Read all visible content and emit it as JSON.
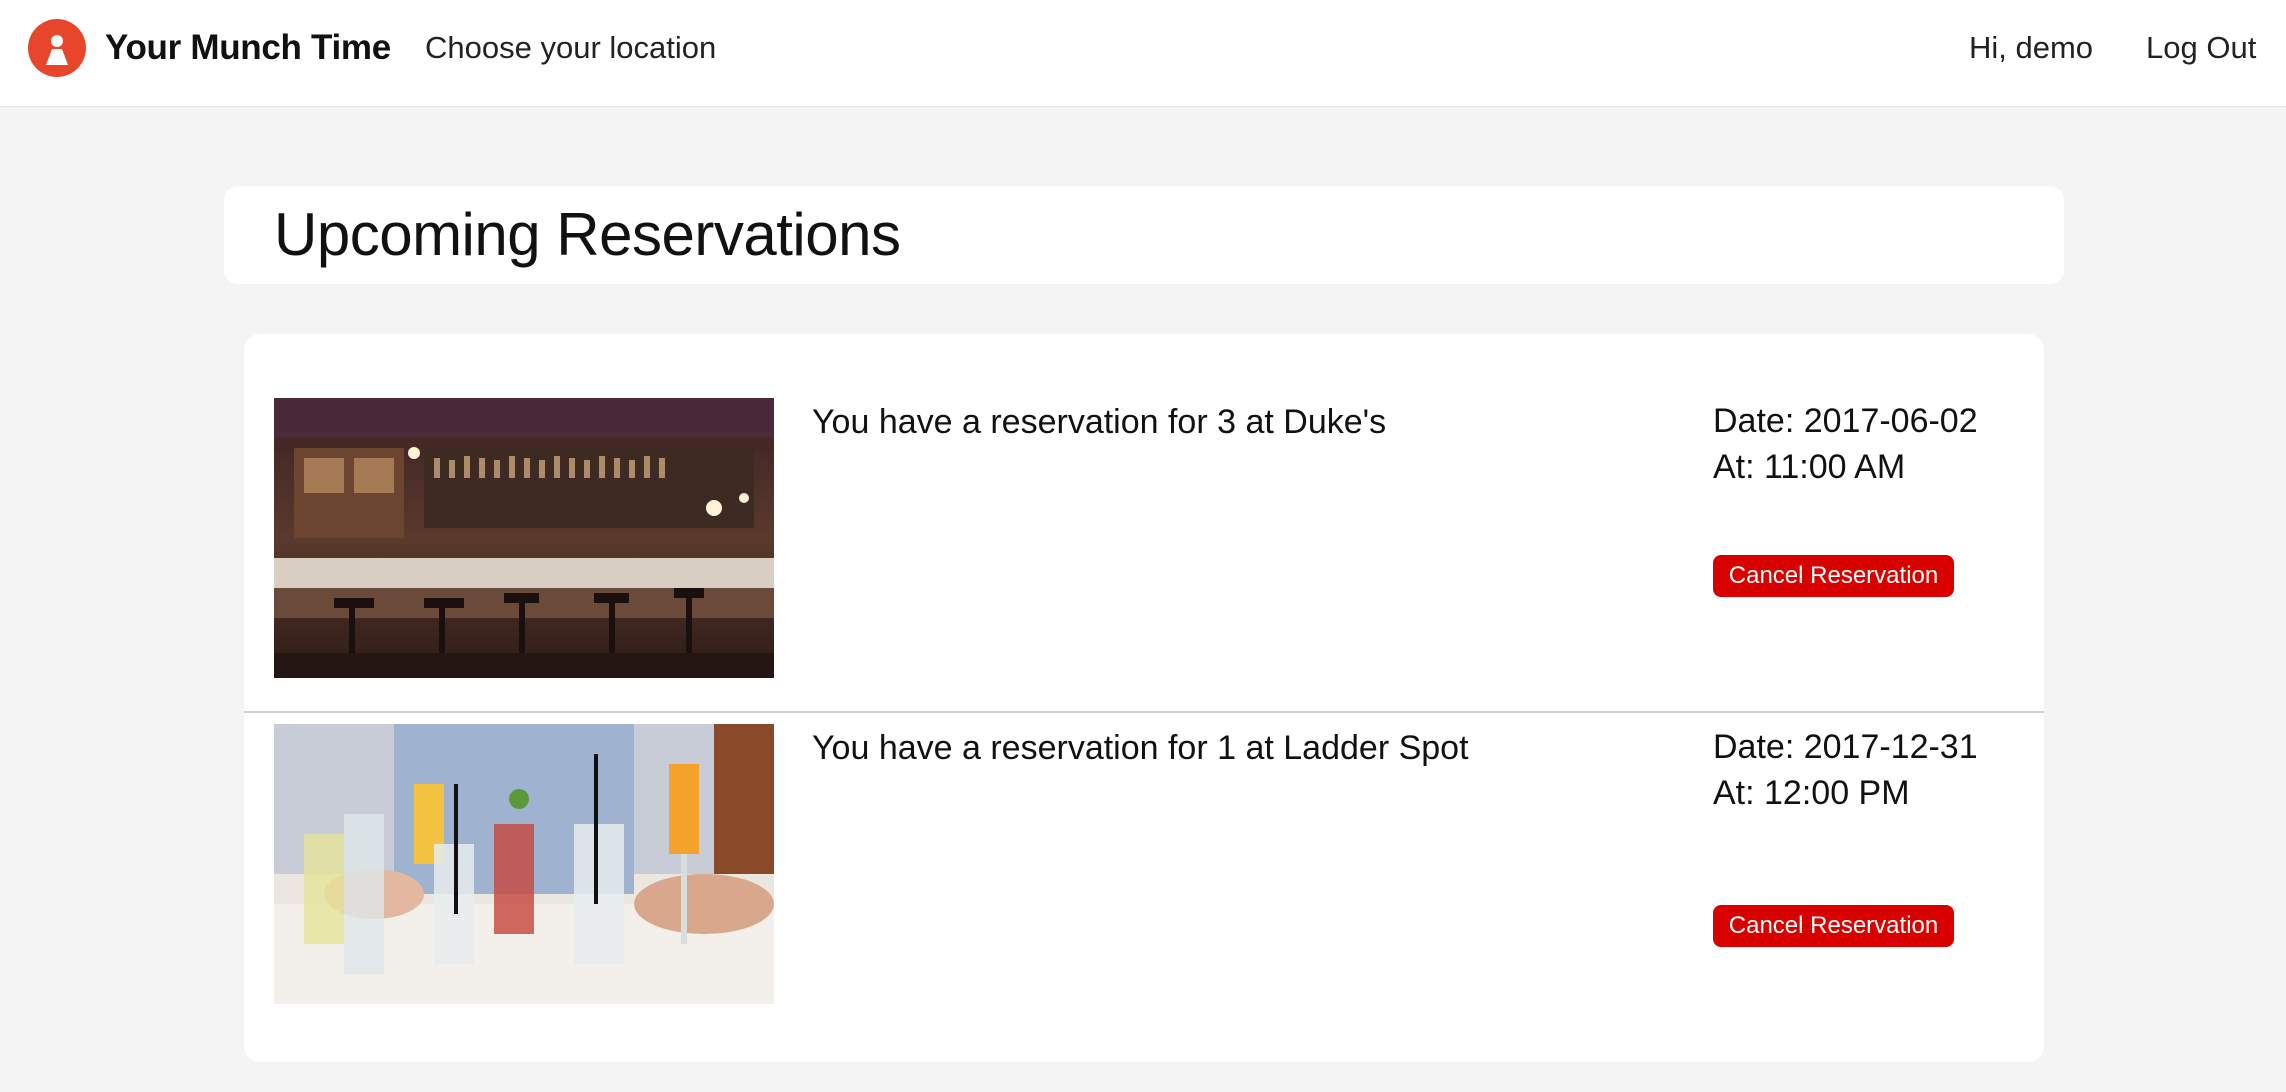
{
  "header": {
    "brand": "Your Munch Time",
    "logo_icon": "person-pin-icon",
    "location_link": "Choose your location",
    "greeting": "Hi, demo",
    "logout": "Log Out",
    "accent_color": "#e8462b"
  },
  "main": {
    "title": "Upcoming Reservations",
    "reservations": [
      {
        "text": "You have a reservation for 3 at Duke's",
        "date": "Date: 2017-06-02",
        "time": "At: 11:00 AM",
        "cancel_label": "Cancel Reservation",
        "photo": "bar-interior-photo"
      },
      {
        "text": "You have a reservation for 1 at Ladder Spot",
        "date": "Date: 2017-12-31",
        "time": "At: 12:00 PM",
        "cancel_label": "Cancel Reservation",
        "photo": "cocktails-photo"
      }
    ],
    "cancel_color": "#d90000"
  }
}
